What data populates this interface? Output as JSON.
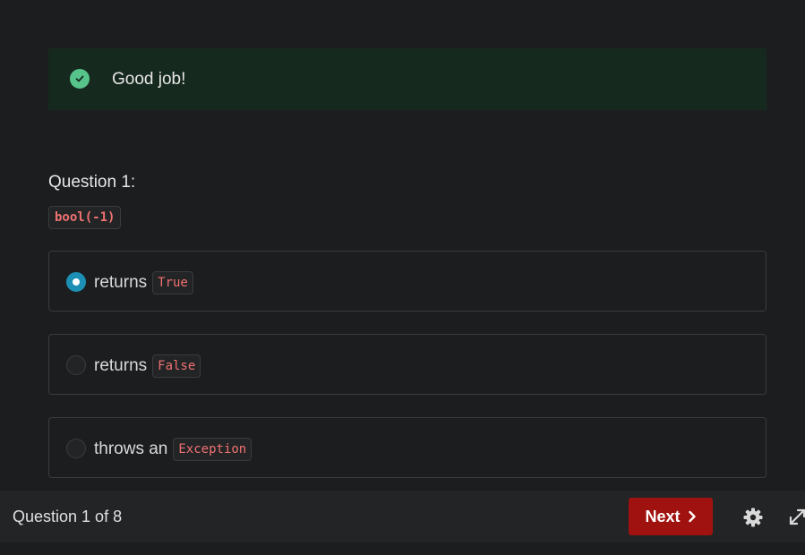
{
  "feedback": {
    "message": "Good job!",
    "icon": "check-circle-icon",
    "accent": "#57c48b"
  },
  "question": {
    "label": "Question 1:",
    "code": "bool(-1)"
  },
  "options": [
    {
      "text": "returns",
      "code": "True",
      "selected": true
    },
    {
      "text": "returns",
      "code": "False",
      "selected": false
    },
    {
      "text": "throws an",
      "code": "Exception",
      "selected": false
    }
  ],
  "footer": {
    "progress": "Question 1 of 8",
    "next_label": "Next",
    "next_color": "#a0120f",
    "icons": [
      "chevron-right-icon",
      "gear-icon",
      "expand-icon"
    ]
  }
}
